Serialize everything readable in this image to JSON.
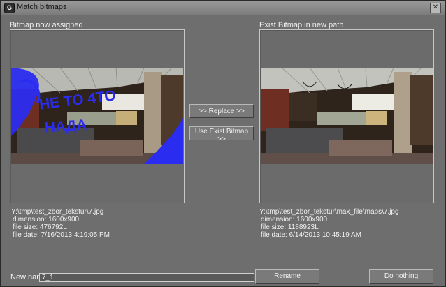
{
  "window": {
    "title": "Match bitmaps",
    "close_glyph": "✕",
    "app_icon_glyph": "G"
  },
  "left": {
    "heading": "Bitmap now assigned",
    "path": "Y:\\tmp\\test_zbor_tekstur\\7.jpg",
    "dimension": "dimension: 1600x900",
    "file_size": "file size: 476792L",
    "file_date": "file date: 7/16/2013 4:19:05 PM",
    "scribble_lines": [
      "HE TO 4TO",
      "HAДA"
    ]
  },
  "right": {
    "heading": "Exist Bitmap in new path",
    "path": "Y:\\tmp\\test_zbor_tekstur\\max_file\\maps\\7.jpg",
    "dimension": "dimension: 1600x900",
    "file_size": "file size: 1188923L",
    "file_date": "file date: 6/14/2013 10:45:19 AM"
  },
  "buttons": {
    "replace": ">> Replace >>",
    "use_exist": "Use Exist Bitmap >>",
    "rename": "Rename",
    "do_nothing": "Do nothing"
  },
  "new_name": {
    "label": "New name",
    "value": "7_1"
  },
  "colors": {
    "scribble": "#2a2cf0",
    "frame": "#c8c8c8",
    "window_bg": "#6e6e6e"
  }
}
